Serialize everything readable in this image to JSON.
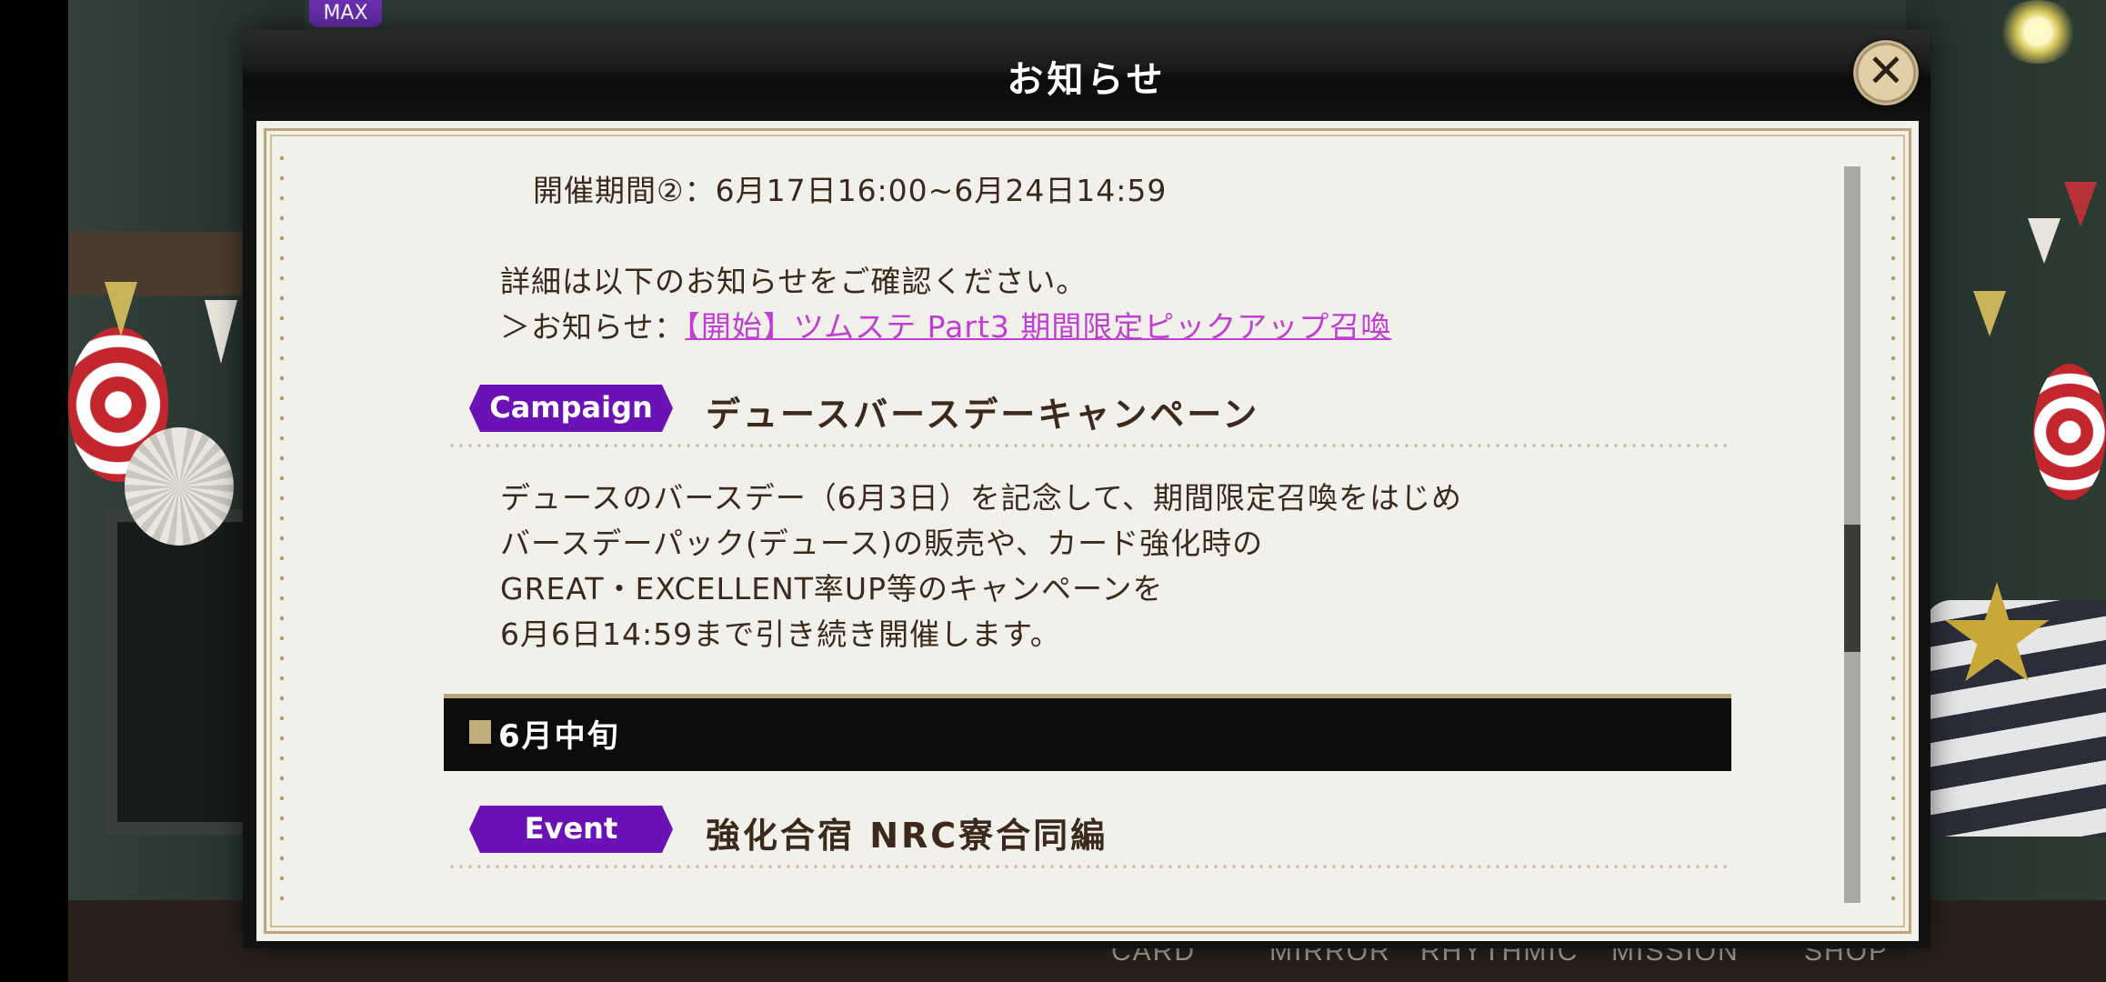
{
  "background": {
    "max_badge": "MAX",
    "nav": [
      "CARD",
      "MIRROR",
      "RHYTHMIC",
      "MISSION",
      "SHOP"
    ]
  },
  "dialog": {
    "title": "お知らせ",
    "close_symbol": "✕"
  },
  "notice": {
    "period_line": "開催期間②：6月17日16:00~6月24日14:59",
    "detail_line": "詳細は以下のお知らせをご確認ください。",
    "link_prefix": "＞お知らせ：",
    "link_text": "【開始】ツムステ Part3 期間限定ピックアップ召喚",
    "campaign": {
      "tag": "Campaign",
      "title": "デュースバースデーキャンペーン",
      "body": [
        "デュースのバースデー（6月3日）を記念して、期間限定召喚をはじめ",
        "バースデーパック(デュース)の販売や、カード強化時の",
        "GREAT・EXCELLENT率UP等のキャンペーンを",
        "6月6日14:59まで引き続き開催します。"
      ]
    },
    "section": "6月中旬",
    "event": {
      "tag": "Event",
      "title": "強化合宿 NRC寮合同編"
    }
  },
  "colors": {
    "tag_purple": "#6a12b5",
    "link_magenta": "#c03fd2",
    "text_brown": "#3b2a1c",
    "paper": "#f2f0ea",
    "gold_border": "#bda57a"
  },
  "icons": {
    "close": "close-icon",
    "section_marker": "square-bullet-icon"
  }
}
